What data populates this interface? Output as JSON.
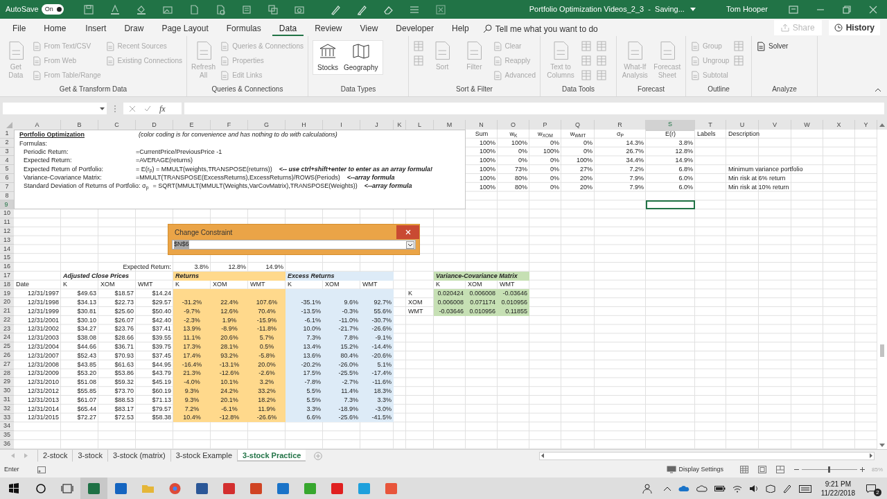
{
  "title_bar": {
    "autosave_label": "AutoSave",
    "autosave": {
      "label": "On",
      "on": true
    },
    "title": "Portfolio Optimization Videos_2_3  -  Saving...",
    "user": "Tom Hooper"
  },
  "menu_tabs": [
    {
      "label": "File",
      "selected": false
    },
    {
      "label": "Home",
      "selected": false
    },
    {
      "label": "Insert",
      "selected": false
    },
    {
      "label": "Draw",
      "selected": false
    },
    {
      "label": "Page Layout",
      "selected": false
    },
    {
      "label": "Formulas",
      "selected": false
    },
    {
      "label": "Data",
      "selected": true
    },
    {
      "label": "Review",
      "selected": false
    },
    {
      "label": "View",
      "selected": false
    },
    {
      "label": "Developer",
      "selected": false
    },
    {
      "label": "Help",
      "selected": false
    }
  ],
  "tell_me": "Tell me what you want to do",
  "share": {
    "label": "Share",
    "disabled": true
  },
  "history": {
    "label": "History",
    "disabled": false
  },
  "ribbon": [
    {
      "label": "Get & Transform Data",
      "items": [
        {
          "kind": "large",
          "label": "Get Data",
          "disabled": true
        },
        {
          "kind": "small",
          "label": "From Text/CSV",
          "disabled": true
        },
        {
          "kind": "small",
          "label": "From Web",
          "disabled": true
        },
        {
          "kind": "small",
          "label": "From Table/Range",
          "disabled": true
        },
        {
          "kind": "small",
          "label": "Recent Sources",
          "disabled": true
        },
        {
          "kind": "small",
          "label": "Existing Connections",
          "disabled": true
        }
      ]
    },
    {
      "label": "Queries & Connections",
      "items": [
        {
          "kind": "large",
          "label": "Refresh All",
          "disabled": true
        },
        {
          "kind": "small",
          "label": "Queries & Connections",
          "disabled": true
        },
        {
          "kind": "small",
          "label": "Properties",
          "disabled": true
        },
        {
          "kind": "small",
          "label": "Edit Links",
          "disabled": true
        }
      ]
    },
    {
      "label": "Data Types",
      "items": [
        {
          "kind": "gallery",
          "label": "Stocks",
          "disabled": false
        },
        {
          "kind": "gallery",
          "label": "Geography",
          "disabled": false
        }
      ]
    },
    {
      "label": "Sort & Filter",
      "items": [
        {
          "kind": "icon",
          "disabled": true
        },
        {
          "kind": "icon",
          "disabled": true
        },
        {
          "kind": "large",
          "label": "Sort",
          "disabled": true
        },
        {
          "kind": "large",
          "label": "Filter",
          "disabled": true
        },
        {
          "kind": "small",
          "label": "Clear",
          "disabled": true
        },
        {
          "kind": "small",
          "label": "Reapply",
          "disabled": true
        },
        {
          "kind": "small",
          "label": "Advanced",
          "disabled": true
        }
      ]
    },
    {
      "label": "Data Tools",
      "items": [
        {
          "kind": "large",
          "label": "Text to Columns",
          "disabled": true
        },
        {
          "kind": "icon",
          "disabled": true
        },
        {
          "kind": "icon",
          "disabled": true
        },
        {
          "kind": "icon",
          "disabled": true
        },
        {
          "kind": "icon",
          "disabled": true
        },
        {
          "kind": "icon",
          "disabled": true
        },
        {
          "kind": "icon",
          "disabled": true
        }
      ]
    },
    {
      "label": "Forecast",
      "items": [
        {
          "kind": "large",
          "label": "What-If Analysis",
          "disabled": true
        },
        {
          "kind": "large",
          "label": "Forecast Sheet",
          "disabled": true
        }
      ]
    },
    {
      "label": "Outline",
      "items": [
        {
          "kind": "small",
          "label": "Group",
          "disabled": true
        },
        {
          "kind": "small",
          "label": "Ungroup",
          "disabled": true
        },
        {
          "kind": "small",
          "label": "Subtotal",
          "disabled": true
        },
        {
          "kind": "icon",
          "disabled": true
        },
        {
          "kind": "icon",
          "disabled": true
        }
      ]
    },
    {
      "label": "Analyze",
      "items": [
        {
          "kind": "small",
          "label": "Solver",
          "disabled": false
        }
      ]
    }
  ],
  "formula_bar": {
    "function_label": "fx"
  },
  "columns": [
    {
      "label": "A",
      "selected": false
    },
    {
      "label": "B",
      "selected": false
    },
    {
      "label": "C",
      "selected": false
    },
    {
      "label": "D",
      "selected": false
    },
    {
      "label": "E",
      "selected": false
    },
    {
      "label": "F",
      "selected": false
    },
    {
      "label": "G",
      "selected": false
    },
    {
      "label": "H",
      "selected": false
    },
    {
      "label": "I",
      "selected": false
    },
    {
      "label": "J",
      "selected": false
    },
    {
      "label": "K",
      "selected": false
    },
    {
      "label": "L",
      "selected": false
    },
    {
      "label": "M",
      "selected": false
    },
    {
      "label": "N",
      "selected": false
    },
    {
      "label": "O",
      "selected": false
    },
    {
      "label": "P",
      "selected": false
    },
    {
      "label": "Q",
      "selected": false
    },
    {
      "label": "R",
      "selected": false
    },
    {
      "label": "S",
      "selected": true
    },
    {
      "label": "T",
      "selected": false
    },
    {
      "label": "U",
      "selected": false
    },
    {
      "label": "V",
      "selected": false
    },
    {
      "label": "W",
      "selected": false
    },
    {
      "label": "X",
      "selected": false
    },
    {
      "label": "Y",
      "selected": false
    }
  ],
  "rows": [
    {
      "number": "1",
      "selected": false
    },
    {
      "number": "2",
      "selected": false
    },
    {
      "number": "3",
      "selected": false
    },
    {
      "number": "4",
      "selected": false
    },
    {
      "number": "5",
      "selected": false
    },
    {
      "number": "6",
      "selected": false
    },
    {
      "number": "7",
      "selected": false
    },
    {
      "number": "8",
      "selected": false
    },
    {
      "number": "9",
      "selected": true
    },
    {
      "number": "10",
      "selected": false
    },
    {
      "number": "11",
      "selected": false
    },
    {
      "number": "12",
      "selected": false
    },
    {
      "number": "13",
      "selected": false
    },
    {
      "number": "14",
      "selected": false
    },
    {
      "number": "15",
      "selected": false
    },
    {
      "number": "16",
      "selected": false
    },
    {
      "number": "17",
      "selected": false
    },
    {
      "number": "18",
      "selected": false
    },
    {
      "number": "19",
      "selected": false
    },
    {
      "number": "20",
      "selected": false
    },
    {
      "number": "21",
      "selected": false
    },
    {
      "number": "22",
      "selected": false
    },
    {
      "number": "23",
      "selected": false
    },
    {
      "number": "24",
      "selected": false
    },
    {
      "number": "25",
      "selected": false
    },
    {
      "number": "26",
      "selected": false
    },
    {
      "number": "27",
      "selected": false
    },
    {
      "number": "28",
      "selected": false
    },
    {
      "number": "29",
      "selected": false
    },
    {
      "number": "30",
      "selected": false
    },
    {
      "number": "31",
      "selected": false
    },
    {
      "number": "32",
      "selected": false
    },
    {
      "number": "33",
      "selected": false
    },
    {
      "number": "34",
      "selected": false
    },
    {
      "number": "35",
      "selected": false
    },
    {
      "number": "36",
      "selected": false
    }
  ],
  "note_box": [
    {
      "kind": "title",
      "label": "Portfolio Optimization",
      "comment": "(color coding is for convenience and has nothing to do with calculations)"
    },
    {
      "kind": "plain",
      "label": "Formulas:"
    },
    {
      "kind": "formula",
      "label": "Periodic Return:",
      "formula": "=CurrentPrice/PreviousPrice -1"
    },
    {
      "kind": "formula",
      "label": "Expected Return:",
      "formula": "=AVERAGE(returns)"
    },
    {
      "kind": "formula",
      "label": "Expected Return of Portfolio:",
      "formula": "= E(r$_{p}$) =  MMULT(weights,TRANSPOSE(returns))",
      "comment": "<-- use ctrl+shift+enter to enter as an array formula!"
    },
    {
      "kind": "formula",
      "label": "Variance-Covariance Matrix:",
      "formula": "=MMULT(TRANSPOSE(ExcessReturns),ExcessReturns)/ROWS(Periods)",
      "comment": "<--array formula"
    },
    {
      "kind": "formula",
      "label": "Standard Deviation of Returns of Portfolio: σ$_{p}$",
      "formula": "= SQRT(MMULT(MMULT(Weights,VarCovMatrix),TRANSPOSE(Weights))",
      "comment": "<--array formula"
    }
  ],
  "weights_table": {
    "columns": [
      "Sum",
      "w$_{K}$",
      "w$_{XOM}$",
      "w$_{WMT}$",
      "σ$_{P}$",
      "E(r)"
    ],
    "labels_heading": "Labels",
    "description_heading": "Description",
    "rows": [
      {
        "values": [
          "100%",
          "100%",
          "0%",
          "0%",
          "14.3%",
          "3.8%"
        ]
      },
      {
        "values": [
          "100%",
          "0%",
          "100%",
          "0%",
          "26.7%",
          "12.8%"
        ]
      },
      {
        "values": [
          "100%",
          "0%",
          "0%",
          "100%",
          "34.4%",
          "14.9%"
        ]
      },
      {
        "values": [
          "100%",
          "73%",
          "0%",
          "27%",
          "7.2%",
          "6.8%"
        ],
        "description": "Minimum variance portfolio"
      },
      {
        "values": [
          "100%",
          "80%",
          "0%",
          "20%",
          "7.9%",
          "6.0%"
        ],
        "description": "Min risk at 6% return"
      },
      {
        "values": [
          "100%",
          "80%",
          "0%",
          "20%",
          "7.9%",
          "6.0%"
        ],
        "description": "Min risk at 10% return"
      }
    ]
  },
  "expected_return": {
    "label": "Expected Return:",
    "values": [
      "3.8%",
      "12.8%",
      "14.9%"
    ]
  },
  "prices": {
    "title": "Adjusted Close Prices",
    "columns": [
      "Date",
      "K",
      "XOM",
      "WMT"
    ]
  },
  "returns": {
    "title": "Returns",
    "columns": [
      "K",
      "XOM",
      "WMT"
    ],
    "color": "#ffd98c"
  },
  "excess_returns": {
    "title": "Excess Returns",
    "columns": [
      "K",
      "XOM",
      "WMT"
    ],
    "color": "#ddebf7"
  },
  "data_rows": [
    {
      "date": "12/31/1997",
      "prices": [
        "$49.63",
        "$18.57",
        "$14.24"
      ]
    },
    {
      "date": "12/31/1998",
      "prices": [
        "$34.13",
        "$22.73",
        "$29.57"
      ],
      "returns": [
        "-31.2%",
        "22.4%",
        "107.6%"
      ],
      "excess": [
        "-35.1%",
        "9.6%",
        "92.7%"
      ]
    },
    {
      "date": "12/31/1999",
      "prices": [
        "$30.81",
        "$25.60",
        "$50.40"
      ],
      "returns": [
        "-9.7%",
        "12.6%",
        "70.4%"
      ],
      "excess": [
        "-13.5%",
        "-0.3%",
        "55.6%"
      ]
    },
    {
      "date": "12/31/2001",
      "prices": [
        "$30.10",
        "$26.07",
        "$42.40"
      ],
      "returns": [
        "-2.3%",
        "1.9%",
        "-15.9%"
      ],
      "excess": [
        "-6.1%",
        "-11.0%",
        "-30.7%"
      ]
    },
    {
      "date": "12/31/2002",
      "prices": [
        "$34.27",
        "$23.76",
        "$37.41"
      ],
      "returns": [
        "13.9%",
        "-8.9%",
        "-11.8%"
      ],
      "excess": [
        "10.0%",
        "-21.7%",
        "-26.6%"
      ]
    },
    {
      "date": "12/31/2003",
      "prices": [
        "$38.08",
        "$28.66",
        "$39.55"
      ],
      "returns": [
        "11.1%",
        "20.6%",
        "5.7%"
      ],
      "excess": [
        "7.3%",
        "7.8%",
        "-9.1%"
      ]
    },
    {
      "date": "12/31/2004",
      "prices": [
        "$44.66",
        "$36.71",
        "$39.75"
      ],
      "returns": [
        "17.3%",
        "28.1%",
        "0.5%"
      ],
      "excess": [
        "13.4%",
        "15.2%",
        "-14.4%"
      ]
    },
    {
      "date": "12/31/2007",
      "prices": [
        "$52.43",
        "$70.93",
        "$37.45"
      ],
      "returns": [
        "17.4%",
        "93.2%",
        "-5.8%"
      ],
      "excess": [
        "13.6%",
        "80.4%",
        "-20.6%"
      ]
    },
    {
      "date": "12/31/2008",
      "prices": [
        "$43.85",
        "$61.63",
        "$44.95"
      ],
      "returns": [
        "-16.4%",
        "-13.1%",
        "20.0%"
      ],
      "excess": [
        "-20.2%",
        "-26.0%",
        "5.1%"
      ]
    },
    {
      "date": "12/31/2009",
      "prices": [
        "$53.20",
        "$53.86",
        "$43.79"
      ],
      "returns": [
        "21.3%",
        "-12.6%",
        "-2.6%"
      ],
      "excess": [
        "17.5%",
        "-25.5%",
        "-17.4%"
      ]
    },
    {
      "date": "12/31/2010",
      "prices": [
        "$51.08",
        "$59.32",
        "$45.19"
      ],
      "returns": [
        "-4.0%",
        "10.1%",
        "3.2%"
      ],
      "excess": [
        "-7.8%",
        "-2.7%",
        "-11.6%"
      ]
    },
    {
      "date": "12/31/2012",
      "prices": [
        "$55.85",
        "$73.70",
        "$60.19"
      ],
      "returns": [
        "9.3%",
        "24.2%",
        "33.2%"
      ],
      "excess": [
        "5.5%",
        "11.4%",
        "18.3%"
      ]
    },
    {
      "date": "12/31/2013",
      "prices": [
        "$61.07",
        "$88.53",
        "$71.13"
      ],
      "returns": [
        "9.3%",
        "20.1%",
        "18.2%"
      ],
      "excess": [
        "5.5%",
        "7.3%",
        "3.3%"
      ]
    },
    {
      "date": "12/31/2014",
      "prices": [
        "$65.44",
        "$83.17",
        "$79.57"
      ],
      "returns": [
        "7.2%",
        "-6.1%",
        "11.9%"
      ],
      "excess": [
        "3.3%",
        "-18.9%",
        "-3.0%"
      ]
    },
    {
      "date": "12/31/2015",
      "prices": [
        "$72.27",
        "$72.53",
        "$58.38"
      ],
      "returns": [
        "10.4%",
        "-12.8%",
        "-26.6%"
      ],
      "excess": [
        "6.6%",
        "-25.6%",
        "-41.5%"
      ]
    }
  ],
  "matrix": {
    "title": "Variance-Covariance Matrix",
    "columns": [
      "K",
      "XOM",
      "WMT"
    ],
    "color": "#c6e0b4",
    "rows": [
      {
        "label": "K",
        "values": [
          "0.020424",
          "0.006008",
          "-0.03646"
        ]
      },
      {
        "label": "XOM",
        "values": [
          "0.006008",
          "0.071174",
          "0.010956"
        ]
      },
      {
        "label": "WMT",
        "values": [
          "-0.03646",
          "0.010956",
          "0.11855"
        ]
      }
    ]
  },
  "dialog": {
    "title": "Change Constraint",
    "value": "$N$6",
    "value_selected": true
  },
  "sheet_tabs": [
    {
      "label": "2-stock",
      "selected": false
    },
    {
      "label": "3-stock",
      "selected": false
    },
    {
      "label": "3-stock (matrix)",
      "selected": false
    },
    {
      "label": "3-stock Example",
      "selected": false
    },
    {
      "label": "3-stock Practice",
      "selected": true
    }
  ],
  "status_bar": {
    "mode": "Enter",
    "display_settings": "Display Settings",
    "zoom": {
      "level": 0.5,
      "reading": "85%"
    }
  },
  "taskbar": {
    "time": "9:21 PM",
    "date": "11/22/2018",
    "notifications": "2"
  }
}
